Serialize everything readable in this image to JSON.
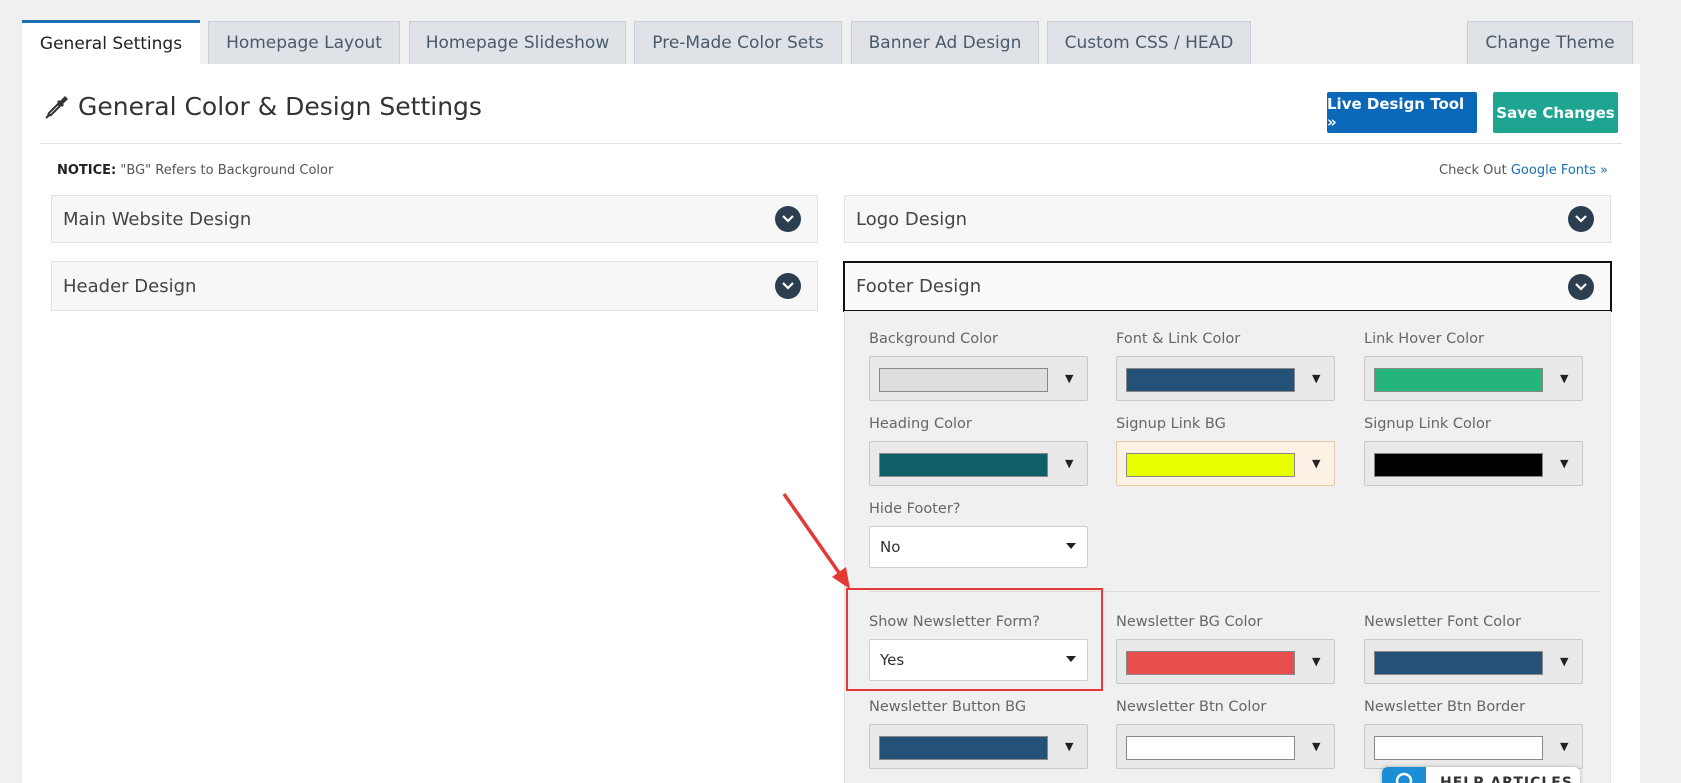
{
  "tabs": [
    {
      "label": "General Settings"
    },
    {
      "label": "Homepage Layout"
    },
    {
      "label": "Homepage Slideshow"
    },
    {
      "label": "Pre-Made Color Sets"
    },
    {
      "label": "Banner Ad Design"
    },
    {
      "label": "Custom CSS / HEAD"
    },
    {
      "label": "Change Theme"
    }
  ],
  "header": {
    "title": "General Color & Design Settings",
    "live_design_label": "Live Design Tool »",
    "save_label": "Save Changes"
  },
  "notice": {
    "prefix": "NOTICE:",
    "text": "\"BG\" Refers to Background Color",
    "check_out": "Check Out",
    "google_fonts": "Google Fonts »"
  },
  "sections": {
    "main_website": "Main Website Design",
    "logo": "Logo Design",
    "header": "Header Design",
    "footer": "Footer Design"
  },
  "footer_fields": {
    "background_color": {
      "label": "Background Color",
      "color": "#dedede"
    },
    "font_link_color": {
      "label": "Font & Link Color",
      "color": "#255078"
    },
    "link_hover_color": {
      "label": "Link Hover Color",
      "color": "#25b57a"
    },
    "heading_color": {
      "label": "Heading Color",
      "color": "#0f5f69"
    },
    "signup_link_bg": {
      "label": "Signup Link BG",
      "color": "#e7ff00"
    },
    "signup_link_color": {
      "label": "Signup Link Color",
      "color": "#000000"
    },
    "hide_footer": {
      "label": "Hide Footer?",
      "value": "No"
    },
    "show_newsletter": {
      "label": "Show Newsletter Form?",
      "value": "Yes"
    },
    "newsletter_bg": {
      "label": "Newsletter BG Color",
      "color": "#e84e4e"
    },
    "newsletter_font": {
      "label": "Newsletter Font Color",
      "color": "#255078"
    },
    "newsletter_button_bg": {
      "label": "Newsletter Button BG",
      "color": "#255078"
    },
    "newsletter_btn_color": {
      "label": "Newsletter Btn Color",
      "color": "#ffffff"
    },
    "newsletter_btn_border": {
      "label": "Newsletter Btn Border",
      "color": "#ffffff"
    }
  },
  "help_widget": {
    "label": "HELP ARTICLES"
  },
  "colors": {
    "accent": "#0b67b8",
    "save": "#1ea592",
    "annotation": "#e53935"
  }
}
